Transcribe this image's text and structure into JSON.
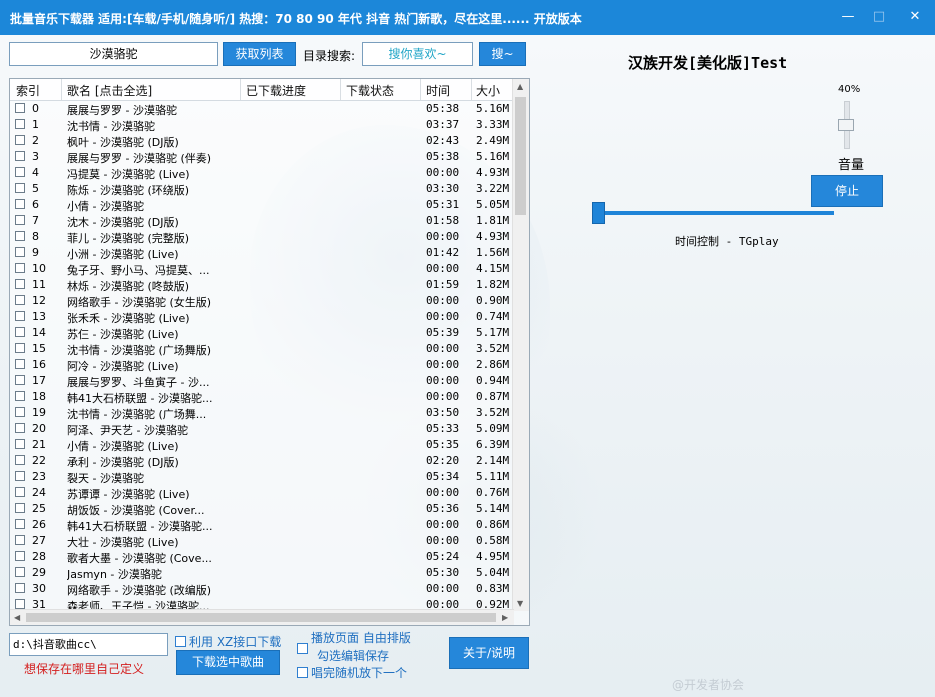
{
  "window": {
    "title": "批量音乐下载器  适用:[车载/手机/随身听/] 热搜：70 80 90 年代 抖音 热门新歌，尽在这里...... 开放版本",
    "minimize": "—",
    "maximize": "□",
    "close": "✕"
  },
  "toolbar": {
    "search_value": "沙漠骆驼",
    "fetch_button": "获取列表",
    "dir_search_label": "目录搜索:",
    "dir_search_value": "搜你喜欢~",
    "search_button": "搜~"
  },
  "table": {
    "headers": [
      "索引",
      "歌名 [点击全选]",
      "已下载进度",
      "下载状态",
      "时间",
      "大小"
    ],
    "rows": [
      {
        "idx": "0",
        "name": "展展与罗罗 - 沙漠骆驼",
        "time": "05:38",
        "size": "5.16M"
      },
      {
        "idx": "1",
        "name": "沈书情 - 沙漠骆驼",
        "time": "03:37",
        "size": "3.33M"
      },
      {
        "idx": "2",
        "name": "枫叶 - 沙漠骆驼 (DJ版)",
        "time": "02:43",
        "size": "2.49M"
      },
      {
        "idx": "3",
        "name": "展展与罗罗 - 沙漠骆驼 (伴奏)",
        "time": "05:38",
        "size": "5.16M"
      },
      {
        "idx": "4",
        "name": "冯提莫 - 沙漠骆驼 (Live)",
        "time": "00:00",
        "size": "4.93M"
      },
      {
        "idx": "5",
        "name": "陈烁 - 沙漠骆驼 (环绕版)",
        "time": "03:30",
        "size": "3.22M"
      },
      {
        "idx": "6",
        "name": "小倩 - 沙漠骆驼",
        "time": "05:31",
        "size": "5.05M"
      },
      {
        "idx": "7",
        "name": "沈木 - 沙漠骆驼 (DJ版)",
        "time": "01:58",
        "size": "1.81M"
      },
      {
        "idx": "8",
        "name": "菲儿 - 沙漠骆驼 (完整版)",
        "time": "00:00",
        "size": "4.93M"
      },
      {
        "idx": "9",
        "name": "小洲 - 沙漠骆驼 (Live)",
        "time": "01:42",
        "size": "1.56M"
      },
      {
        "idx": "10",
        "name": "兔子牙、野小马、冯提莫、...",
        "time": "00:00",
        "size": "4.15M"
      },
      {
        "idx": "11",
        "name": "林烁 - 沙漠骆驼 (咚鼓版)",
        "time": "01:59",
        "size": "1.82M"
      },
      {
        "idx": "12",
        "name": "网络歌手 - 沙漠骆驼 (女生版)",
        "time": "00:00",
        "size": "0.90M"
      },
      {
        "idx": "13",
        "name": "张禾禾 - 沙漠骆驼 (Live)",
        "time": "00:00",
        "size": "0.74M"
      },
      {
        "idx": "14",
        "name": "苏仨 - 沙漠骆驼 (Live)",
        "time": "05:39",
        "size": "5.17M"
      },
      {
        "idx": "15",
        "name": "沈书情 - 沙漠骆驼 (广场舞版)",
        "time": "00:00",
        "size": "3.52M"
      },
      {
        "idx": "16",
        "name": "阿冷 - 沙漠骆驼 (Live)",
        "time": "00:00",
        "size": "2.86M"
      },
      {
        "idx": "17",
        "name": "展展与罗罗、斗鱼寅子 - 沙...",
        "time": "00:00",
        "size": "0.94M"
      },
      {
        "idx": "18",
        "name": "韩41大石桥联盟 - 沙漠骆驼...",
        "time": "00:00",
        "size": "0.87M"
      },
      {
        "idx": "19",
        "name": "沈书情 - 沙漠骆驼 (广场舞...",
        "time": "03:50",
        "size": "3.52M"
      },
      {
        "idx": "20",
        "name": "阿泽、尹天艺 - 沙漠骆驼",
        "time": "05:33",
        "size": "5.09M"
      },
      {
        "idx": "21",
        "name": "小倩 - 沙漠骆驼 (Live)",
        "time": "05:35",
        "size": "6.39M"
      },
      {
        "idx": "22",
        "name": "承利 - 沙漠骆驼 (DJ版)",
        "time": "02:20",
        "size": "2.14M"
      },
      {
        "idx": "23",
        "name": "裂天 - 沙漠骆驼",
        "time": "05:34",
        "size": "5.11M"
      },
      {
        "idx": "24",
        "name": "苏谭谭 - 沙漠骆驼 (Live)",
        "time": "00:00",
        "size": "0.76M"
      },
      {
        "idx": "25",
        "name": "胡饭饭 - 沙漠骆驼 (Cover...",
        "time": "05:36",
        "size": "5.14M"
      },
      {
        "idx": "26",
        "name": "韩41大石桥联盟 - 沙漠骆驼...",
        "time": "00:00",
        "size": "0.86M"
      },
      {
        "idx": "27",
        "name": "大壮 - 沙漠骆驼 (Live)",
        "time": "00:00",
        "size": "0.58M"
      },
      {
        "idx": "28",
        "name": "歌者大墨 - 沙漠骆驼 (Cove...",
        "time": "05:24",
        "size": "4.95M"
      },
      {
        "idx": "29",
        "name": "Jasmyn - 沙漠骆驼",
        "time": "05:30",
        "size": "5.04M"
      },
      {
        "idx": "30",
        "name": "网络歌手 - 沙漠骆驼 (改编版)",
        "time": "00:00",
        "size": "0.83M"
      },
      {
        "idx": "31",
        "name": "森老师、王子恺 - 沙漠骆驼...",
        "time": "00:00",
        "size": "0.92M"
      }
    ]
  },
  "bottom": {
    "path_value": "d:\\抖音歌曲cc\\",
    "path_hint": "想保存在哪里自己定义",
    "xz_checkbox": "利用 XZ接口下载",
    "download_button": "下载选中歌曲",
    "playpage_label": "播放页面 自由排版",
    "edit_save_checkbox": "勾选编辑保存",
    "random_checkbox": "唱完随机放下一个",
    "about_button": "关于/说明"
  },
  "player": {
    "title": "汉族开发[美化版]Test",
    "volume_percent": "40%",
    "volume_value": 40,
    "volume_label": "音量",
    "stop_button": "停止",
    "progress_value": 0,
    "time_control_label": "时间控制 - TGplay"
  },
  "watermark": "@开发者协会"
}
